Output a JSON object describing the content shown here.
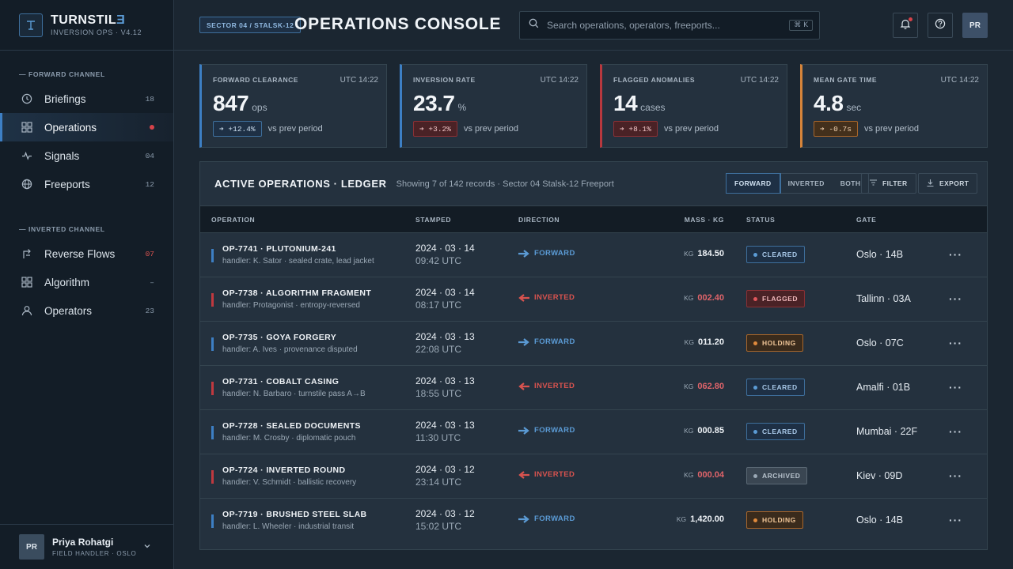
{
  "brand": {
    "name": "TURNSTIL",
    "name_accent": "Ǝ",
    "subtitle": "INVERSION OPS · V4.12"
  },
  "sidebar": {
    "sections": [
      {
        "label": "— FORWARD CHANNEL"
      },
      {
        "label": "— INVERTED CHANNEL"
      }
    ],
    "items": [
      {
        "label": "Briefings",
        "count": "18",
        "icon": "clock-icon"
      },
      {
        "label": "Operations",
        "count": "",
        "icon": "grid-icon",
        "active": true
      },
      {
        "label": "Signals",
        "count": "04",
        "icon": "pulse-icon"
      },
      {
        "label": "Freeports",
        "count": "12",
        "icon": "globe-icon"
      },
      {
        "label": "Reverse Flows",
        "count": "07",
        "icon": "reverse-arrow-icon"
      },
      {
        "label": "Algorithm",
        "count": "–",
        "icon": "grid-icon"
      },
      {
        "label": "Operators",
        "count": "23",
        "icon": "user-icon"
      }
    ],
    "user": {
      "initials": "PR",
      "name": "Priya Rohatgi",
      "role": "FIELD HANDLER · OSLO"
    }
  },
  "header": {
    "breadcrumb": "SECTOR 04 / STALSK-12",
    "title": "OPERATIONS CONSOLE",
    "search_placeholder": "Search operations, operators, freeports...",
    "search_shortcut": "⌘ K",
    "avatar_initials": "PR"
  },
  "kpis": [
    {
      "label": "FORWARD CLEARANCE",
      "time": "UTC 14:22",
      "value": "847",
      "unit": "ops",
      "delta": "➔ +12.4%",
      "compare": "vs prev period"
    },
    {
      "label": "INVERSION RATE",
      "time": "UTC 14:22",
      "value": "23.7",
      "unit": "%",
      "delta": "➔ +3.2%",
      "compare": "vs prev period"
    },
    {
      "label": "FLAGGED ANOMALIES",
      "time": "UTC 14:22",
      "value": "14",
      "unit": "cases",
      "delta": "➔ +8.1%",
      "compare": "vs prev period"
    },
    {
      "label": "MEAN GATE TIME",
      "time": "UTC 14:22",
      "value": "4.8",
      "unit": "sec",
      "delta": "➔ -0.7s",
      "compare": "vs prev period"
    }
  ],
  "ledger": {
    "title": "ACTIVE OPERATIONS · LEDGER",
    "subtitle": "Showing 7 of 142 records · Sector 04 Stalsk-12 Freeport",
    "segments": [
      "FORWARD",
      "INVERTED",
      "BOTH"
    ],
    "filter_label": "FILTER",
    "export_label": "EXPORT",
    "columns": [
      "OPERATION",
      "STAMPED",
      "DIRECTION",
      "MASS · KG",
      "STATUS",
      "GATE"
    ],
    "mass_unit": "KG",
    "rows": [
      {
        "name": "OP-7741 · PLUTONIUM-241",
        "handler": "handler: K. Sator · sealed crate, lead jacket",
        "date": "2024 · 03 · 14",
        "time": "09:42 UTC",
        "direction": "FORWARD",
        "mass": "184.50",
        "status": "CLEARED",
        "gate": "Oslo · 14B"
      },
      {
        "name": "OP-7738 · ALGORITHM FRAGMENT",
        "handler": "handler: Protagonist · entropy-reversed",
        "date": "2024 · 03 · 14",
        "time": "08:17 UTC",
        "direction": "INVERTED",
        "mass": "002.40",
        "status": "FLAGGED",
        "gate": "Tallinn · 03A"
      },
      {
        "name": "OP-7735 · GOYA FORGERY",
        "handler": "handler: A. Ives · provenance disputed",
        "date": "2024 · 03 · 13",
        "time": "22:08 UTC",
        "direction": "FORWARD",
        "mass": "011.20",
        "status": "HOLDING",
        "gate": "Oslo · 07C"
      },
      {
        "name": "OP-7731 · COBALT CASING",
        "handler": "handler: N. Barbaro · turnstile pass A→B",
        "date": "2024 · 03 · 13",
        "time": "18:55 UTC",
        "direction": "INVERTED",
        "mass": "062.80",
        "status": "CLEARED",
        "gate": "Amalfi · 01B"
      },
      {
        "name": "OP-7728 · SEALED DOCUMENTS",
        "handler": "handler: M. Crosby · diplomatic pouch",
        "date": "2024 · 03 · 13",
        "time": "11:30 UTC",
        "direction": "FORWARD",
        "mass": "000.85",
        "status": "CLEARED",
        "gate": "Mumbai · 22F"
      },
      {
        "name": "OP-7724 · INVERTED ROUND",
        "handler": "handler: V. Schmidt · ballistic recovery",
        "date": "2024 · 03 · 12",
        "time": "23:14 UTC",
        "direction": "INVERTED",
        "mass": "000.04",
        "status": "ARCHIVED",
        "gate": "Kiev · 09D"
      },
      {
        "name": "OP-7719 · BRUSHED STEEL SLAB",
        "handler": "handler: L. Wheeler · industrial transit",
        "date": "2024 · 03 · 12",
        "time": "15:02 UTC",
        "direction": "FORWARD",
        "mass": "1,420.00",
        "status": "HOLDING",
        "gate": "Oslo · 14B"
      }
    ]
  },
  "colors": {
    "forward": "#3d7fc4",
    "inverted": "#c0393f",
    "holding": "#d6843a",
    "background": "#1b2631"
  }
}
